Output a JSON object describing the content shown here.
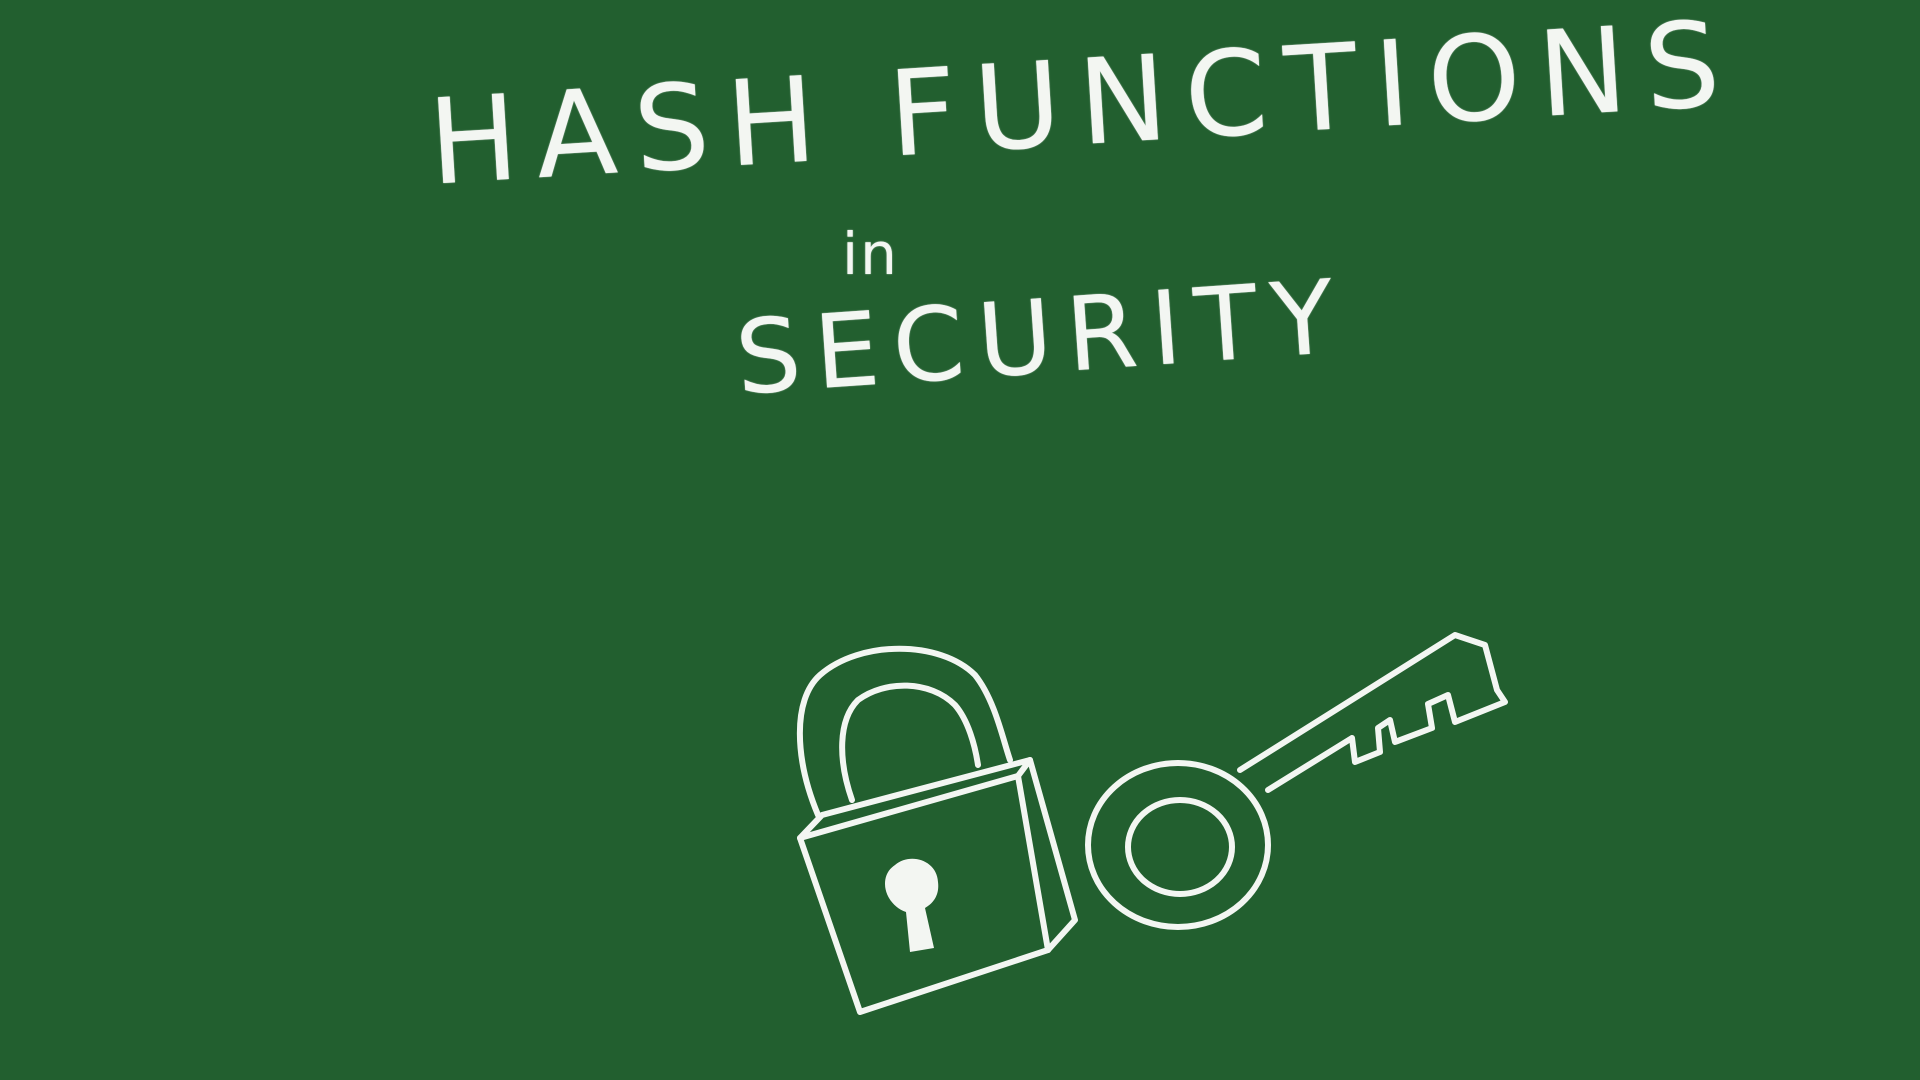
{
  "board": {
    "background_color": "#225f2f",
    "chalk_color": "#f3f6f2"
  },
  "title": {
    "line1": "HASH FUNCTIONS",
    "connector": "in",
    "line2": "SECURITY"
  },
  "illustration": {
    "icons": [
      "padlock-icon",
      "key-icon"
    ]
  }
}
